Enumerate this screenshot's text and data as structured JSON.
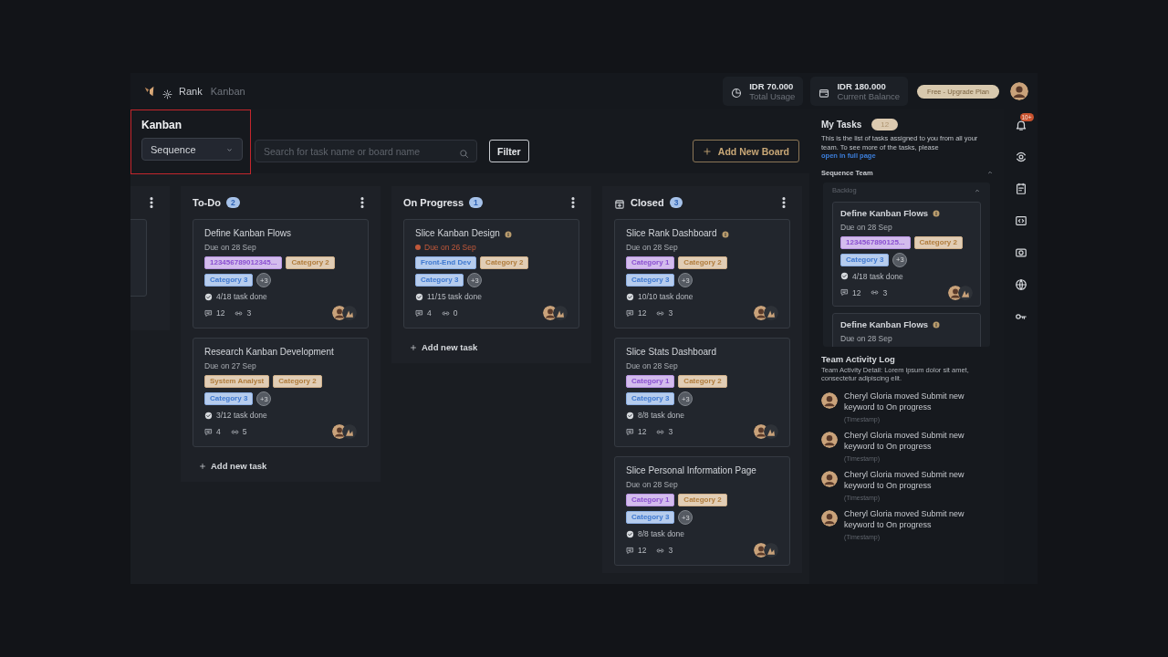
{
  "topbar": {
    "app": "Rank",
    "page": "Kanban",
    "stats": [
      {
        "kind": "usage",
        "value": "IDR 70.000",
        "label": "Total Usage"
      },
      {
        "kind": "balance",
        "value": "IDR 180.000",
        "label": "Current Balance"
      }
    ],
    "upgrade": "Free - Upgrade Plan"
  },
  "header": {
    "title": "Kanban",
    "board_select": "Sequence",
    "search": {
      "placeholder": "Search for task name or board name"
    },
    "filter": "Filter",
    "add_board": "Add New Board"
  },
  "columns": [
    {
      "kind": "cut_off"
    },
    {
      "kind": "full",
      "has_icon": false,
      "title": "To-Do",
      "count": "2",
      "add_task": "Add new task",
      "cards": [
        {
          "title": "Define Kanban Flows",
          "info": false,
          "due": "Due on 28 Sep",
          "overdue": false,
          "tags": [
            {
              "label": "123456789012345...",
              "color": "#8a4fd0"
            },
            {
              "label": "Category 2",
              "color": "#b07c3c"
            },
            {
              "label": "Category 3",
              "color": "#3e78d0"
            }
          ],
          "more": "+3",
          "progress": "4/18 task done",
          "comments": "12",
          "links": "3"
        },
        {
          "title": "Research Kanban Development",
          "info": false,
          "due": "Due on 27 Sep",
          "overdue": false,
          "tags": [
            {
              "label": "System Analyst",
              "color": "#b07c3c"
            },
            {
              "label": "Category 2",
              "color": "#b07c3c"
            },
            {
              "label": "Category 3",
              "color": "#3e78d0"
            }
          ],
          "more": "+3",
          "progress": "3/12 task done",
          "comments": "4",
          "links": "5"
        }
      ]
    },
    {
      "kind": "full",
      "has_icon": false,
      "title": "On Progress",
      "count": "1",
      "add_task": "Add new task",
      "cards": [
        {
          "title": "Slice Kanban Design",
          "info": true,
          "due": "Due on 26 Sep",
          "overdue": true,
          "tags": [
            {
              "label": "Front-End Dev",
              "color": "#3e78d0"
            },
            {
              "label": "Category 2",
              "color": "#b07c3c"
            },
            {
              "label": "Category 3",
              "color": "#3e78d0"
            }
          ],
          "more": "+3",
          "progress": "11/15 task done",
          "comments": "4",
          "links": "0"
        }
      ]
    },
    {
      "kind": "full",
      "has_icon": true,
      "title": "Closed",
      "count": "3",
      "cards": [
        {
          "title": "Slice Rank Dashboard",
          "info": true,
          "due": "Due on 28 Sep",
          "overdue": false,
          "tags": [
            {
              "label": "Category 1",
              "color": "#8a4fd0"
            },
            {
              "label": "Category 2",
              "color": "#b07c3c"
            },
            {
              "label": "Category 3",
              "color": "#3e78d0"
            }
          ],
          "more": "+3",
          "progress": "10/10 task done",
          "comments": "12",
          "links": "3"
        },
        {
          "title": "Slice Stats Dashboard",
          "info": false,
          "due": "Due on 28 Sep",
          "overdue": false,
          "tags": [
            {
              "label": "Category 1",
              "color": "#8a4fd0"
            },
            {
              "label": "Category 2",
              "color": "#b07c3c"
            },
            {
              "label": "Category 3",
              "color": "#3e78d0"
            }
          ],
          "more": "+3",
          "progress": "8/8 task done",
          "comments": "12",
          "links": "3"
        },
        {
          "title": "Slice Personal Information Page",
          "info": false,
          "due": "Due on 28 Sep",
          "overdue": false,
          "tags": [
            {
              "label": "Category 1",
              "color": "#8a4fd0"
            },
            {
              "label": "Category 2",
              "color": "#b07c3c"
            },
            {
              "label": "Category 3",
              "color": "#3e78d0"
            }
          ],
          "more": "+3",
          "progress": "8/8 task done",
          "comments": "12",
          "links": "3"
        }
      ]
    }
  ],
  "my_tasks": {
    "title": "My Tasks",
    "count": "12",
    "description": "This is the list of tasks assigned to you from all your team. To see more of the tasks, please ",
    "link": "open in full page",
    "team": {
      "name": "Sequence Team",
      "expanded": true,
      "group": {
        "name": "Backlog",
        "expanded": true,
        "cards": [
          {
            "title": "Define Kanban Flows",
            "info": true,
            "due": "Due on 28 Sep",
            "overdue": false,
            "tags": [
              {
                "label": "1234567890125...",
                "color": "#8a4fd0"
              },
              {
                "label": "Category 2",
                "color": "#b07c3c"
              },
              {
                "label": "Category 3",
                "color": "#3e78d0"
              }
            ],
            "more": "+3",
            "progress": "4/18 task done",
            "comments": "12",
            "links": "3"
          },
          {
            "title": "Define Kanban Flows",
            "info": true,
            "due": "Due on 28 Sep",
            "overdue": false
          }
        ]
      }
    }
  },
  "activity": {
    "title": "Team Activity Log",
    "detail": "Team Activity Detail: Lorem ipsum dolor sit amet, consectetur adipiscing elit.",
    "entries": [
      {
        "text": "Cheryl Gloria moved Submit new keyword to On progress",
        "time": "(Timestamp)"
      },
      {
        "text": "Cheryl Gloria moved Submit new keyword to On progress",
        "time": "(Timestamp)"
      },
      {
        "text": "Cheryl Gloria moved Submit new keyword to On progress",
        "time": "(Timestamp)"
      },
      {
        "text": "Cheryl Gloria moved Submit new keyword to On progress",
        "time": "(Timestamp)"
      }
    ]
  },
  "notifications": {
    "badge": "10+"
  }
}
